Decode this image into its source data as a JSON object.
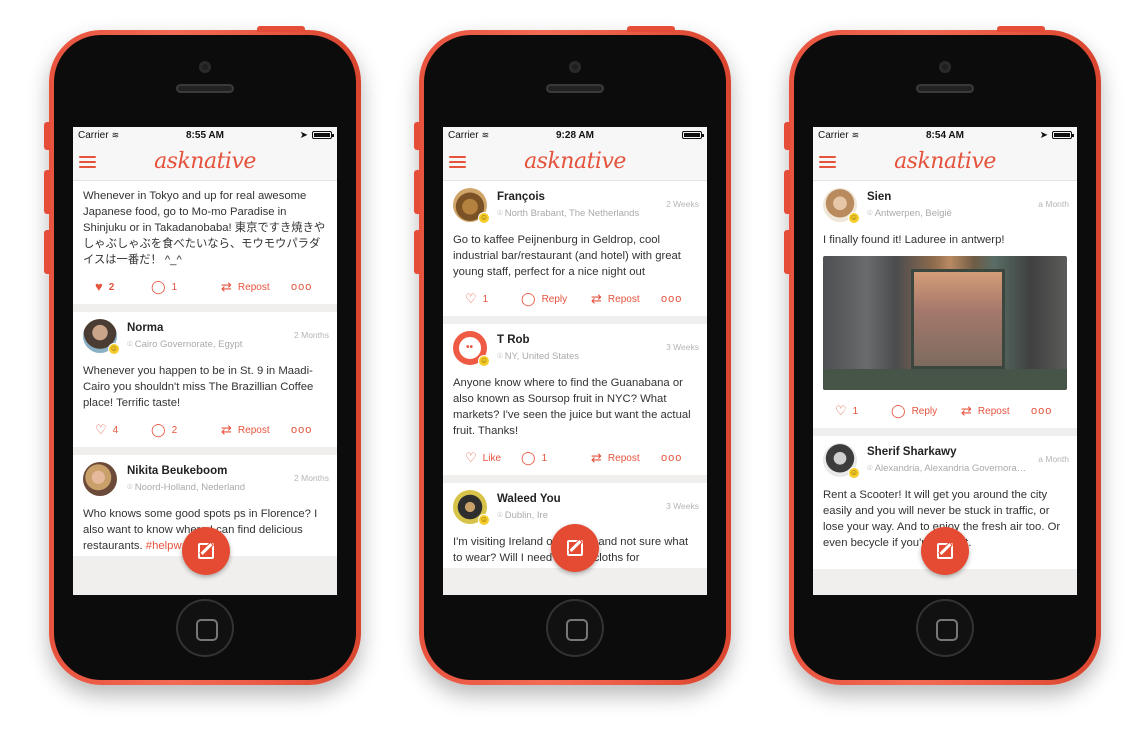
{
  "app": {
    "logo_text": "asknative",
    "accent_color": "#e5533d"
  },
  "phones": [
    {
      "status": {
        "carrier": "Carrier",
        "time": "8:55 AM"
      },
      "posts": [
        {
          "text": "Whenever in Tokyo and up for real awesome Japanese food, go to Mo-mo Paradise in Shinjuku or in Takadanobaba! 東京ですき焼きやしゃぶしゃぶを食べたいなら、モウモウパラダイスは一番だ！ ^_^",
          "like_count": "2",
          "comment_count": "1",
          "repost_label": "Repost",
          "more": "ooo"
        },
        {
          "name": "Norma",
          "location": "Cairo Governorate, Egypt",
          "ago": "2 Months",
          "text": "Whenever you happen to be in St. 9 in Maadi- Cairo you shouldn't miss The Brazillian Coffee place! Terrific taste!",
          "like_count": "4",
          "comment_count": "2",
          "repost_label": "Repost",
          "more": "ooo"
        },
        {
          "name": "Nikita Beukeboom",
          "location": "Noord-Holland, Nederland",
          "ago": "2 Months",
          "text_pre": "Who knows some ",
          "text_hidden": "good spots ",
          "text_mid": "ps in Florence? I also want to know ",
          "text_mid2": "where I c",
          "text_post": "an find delicious restaurants. ",
          "hashtag": "#helpwanted"
        }
      ]
    },
    {
      "status": {
        "carrier": "Carrier",
        "time": "9:28 AM"
      },
      "posts": [
        {
          "name": "François",
          "location": "North Brabant, The Netherlands",
          "ago": "2 Weeks",
          "text": "Go to kaffee Peijnenburg in Geldrop, cool industrial bar/restaurant (and hotel) with great young staff, perfect for a nice night out",
          "like_count": "1",
          "reply_label": "Reply",
          "repost_label": "Repost",
          "more": "ooo"
        },
        {
          "name": "T Rob",
          "location": "NY, United States",
          "ago": "3 Weeks",
          "text": "Anyone know where to find the Guanabana or also known as Soursop fruit in NYC? What markets? I've seen the juice but want the actual fruit. Thanks!",
          "like_label": "Like",
          "comment_count": "1",
          "repost_label": "Repost",
          "more": "ooo"
        },
        {
          "name": "Waleed You",
          "location": "Dublin, Ire",
          "ago": "3 Weeks",
          "text": "I'm visiting Ireland on Oct,27 and not sure what to wear? Will I need special cloths for"
        }
      ]
    },
    {
      "status": {
        "carrier": "Carrier",
        "time": "8:54 AM"
      },
      "posts": [
        {
          "name": "Sien",
          "location": "Antwerpen, België",
          "ago": "a Month",
          "text": "I finally found it! Laduree in antwerp!",
          "like_count": "1",
          "reply_label": "Reply",
          "repost_label": "Repost",
          "more": "ooo"
        },
        {
          "name": "Sherif Sharkawy",
          "location": "Alexandria, Alexandria Governora…",
          "ago": "a Month",
          "text_pre": "Rent a Scooter! It will get you around the city easily and you will never be stuck in traffic, or lose your way. And",
          "text_post": " to enjoy the fresh air too. Or even be",
          "text_end": "cycle if you're fit for it."
        }
      ]
    }
  ]
}
